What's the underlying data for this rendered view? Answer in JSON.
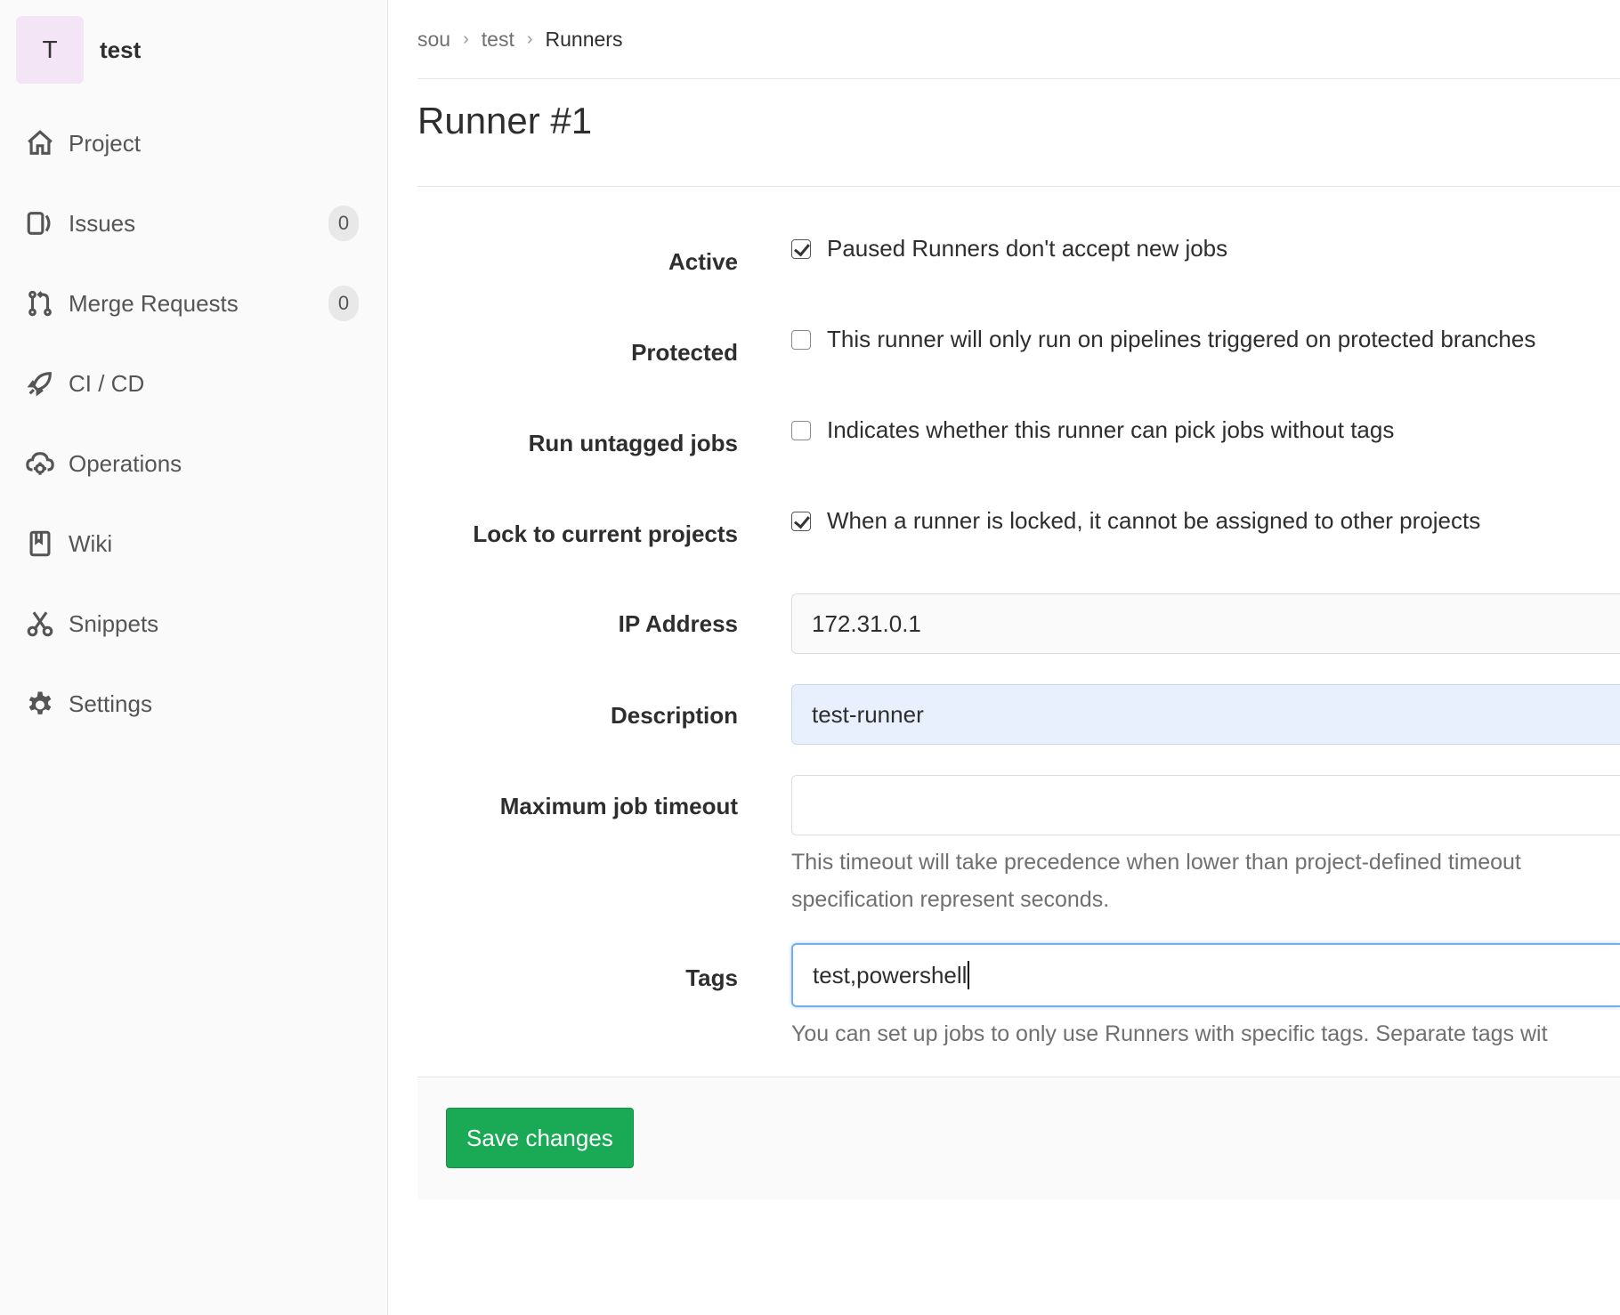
{
  "sidebar": {
    "avatar_letter": "T",
    "project_name": "test",
    "items": [
      {
        "label": "Project",
        "icon": "home-icon"
      },
      {
        "label": "Issues",
        "icon": "issues-icon",
        "badge": "0"
      },
      {
        "label": "Merge Requests",
        "icon": "merge-request-icon",
        "badge": "0"
      },
      {
        "label": "CI / CD",
        "icon": "rocket-icon"
      },
      {
        "label": "Operations",
        "icon": "cloud-gear-icon"
      },
      {
        "label": "Wiki",
        "icon": "book-icon"
      },
      {
        "label": "Snippets",
        "icon": "scissors-icon"
      },
      {
        "label": "Settings",
        "icon": "gear-icon"
      }
    ]
  },
  "breadcrumb": [
    "sou",
    "test",
    "Runners"
  ],
  "page_title": "Runner #1",
  "form": {
    "active": {
      "label": "Active",
      "checked": true,
      "text": "Paused Runners don't accept new jobs"
    },
    "protected": {
      "label": "Protected",
      "checked": false,
      "text": "This runner will only run on pipelines triggered on protected branches"
    },
    "untagged": {
      "label": "Run untagged jobs",
      "checked": false,
      "text": "Indicates whether this runner can pick jobs without tags"
    },
    "locked": {
      "label": "Lock to current projects",
      "checked": true,
      "text": "When a runner is locked, it cannot be assigned to other projects"
    },
    "ip": {
      "label": "IP Address",
      "value": "172.31.0.1"
    },
    "description": {
      "label": "Description",
      "value": "test-runner"
    },
    "timeout": {
      "label": "Maximum job timeout",
      "value": "",
      "help_line1": "This timeout will take precedence when lower than project-defined timeout",
      "help_line2": "specification represent seconds."
    },
    "tags": {
      "label": "Tags",
      "value": "test,powershell",
      "help": "You can set up jobs to only use Runners with specific tags. Separate tags wit"
    }
  },
  "save_label": "Save changes",
  "colors": {
    "save_button": "#1aaa55",
    "focus_border": "#73afea",
    "autofill_bg": "#e8f0fe"
  }
}
